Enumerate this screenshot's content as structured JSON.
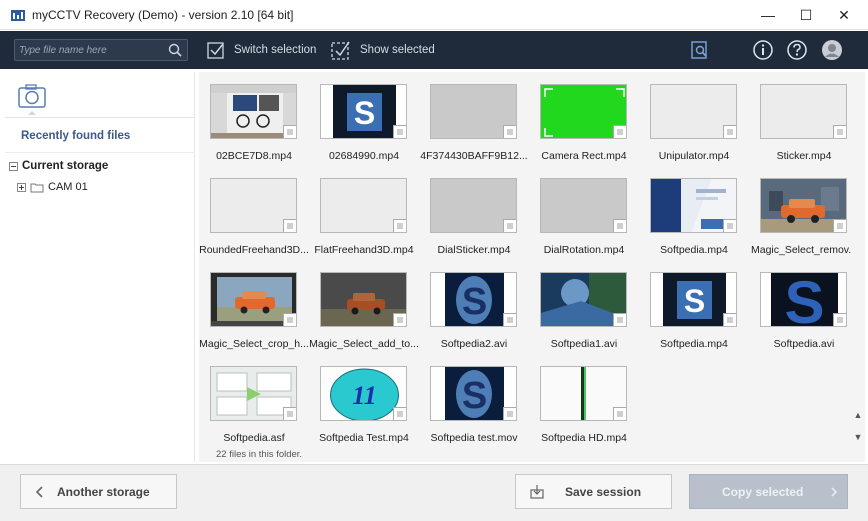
{
  "window": {
    "title": "myCCTV Recovery (Demo) - version 2.10 [64 bit]",
    "controls": {
      "minimize": "—",
      "maximize": "☐",
      "close": "✕"
    }
  },
  "toolbar": {
    "search_placeholder": "Type file name here",
    "switch_selection": "Switch selection",
    "show_selected": "Show selected",
    "icons": [
      "search-icon",
      "scan-icon",
      "info-icon",
      "help-icon",
      "user-avatar-icon"
    ]
  },
  "sidebar": {
    "recent_label": "Recently found files",
    "storage_label": "Current storage",
    "tree_item": "CAM 01"
  },
  "files": [
    {
      "name": "02BCE7D8.mp4",
      "thumb": "room"
    },
    {
      "name": "02684990.mp4",
      "thumb": "s-dark"
    },
    {
      "name": "4F374430BAFF9B12...",
      "thumb": "gray"
    },
    {
      "name": "Camera Rect.mp4",
      "thumb": "green"
    },
    {
      "name": "Unipulator.mp4",
      "thumb": "light"
    },
    {
      "name": "Sticker.mp4",
      "thumb": "light"
    },
    {
      "name": "RoundedFreehand3D...",
      "thumb": "light"
    },
    {
      "name": "FlatFreehand3D.mp4",
      "thumb": "light"
    },
    {
      "name": "DialSticker.mp4",
      "thumb": "gray"
    },
    {
      "name": "DialRotation.mp4",
      "thumb": "gray"
    },
    {
      "name": "Softpedia.mp4",
      "thumb": "softpedia-site"
    },
    {
      "name": "Magic_Select_remov...",
      "thumb": "car"
    },
    {
      "name": "Magic_Select_crop_h...",
      "thumb": "car-frame"
    },
    {
      "name": "Magic_Select_add_to...",
      "thumb": "car-dim"
    },
    {
      "name": "Softpedia2.avi",
      "thumb": "s-glow"
    },
    {
      "name": "Softpedia1.avi",
      "thumb": "blue-photo"
    },
    {
      "name": "Softpedia.mp4",
      "thumb": "s-dark"
    },
    {
      "name": "Softpedia.avi",
      "thumb": "s-big"
    },
    {
      "name": "Softpedia.asf",
      "thumb": "diagram"
    },
    {
      "name": "Softpedia Test.mp4",
      "thumb": "circle-11"
    },
    {
      "name": "Softpedia test.mov",
      "thumb": "s-glow"
    },
    {
      "name": "Softpedia HD.mp4",
      "thumb": "hd"
    }
  ],
  "circle_label": "11",
  "status": "22 files in this folder.",
  "footer": {
    "another_storage": "Another storage",
    "save_session": "Save session",
    "copy_selected": "Copy selected"
  },
  "colors": {
    "toolbar_bg": "#1f2a3a",
    "accent": "#3d5a8a",
    "green_screen": "#22d81e",
    "softpedia_blue": "#2e5a9a"
  }
}
